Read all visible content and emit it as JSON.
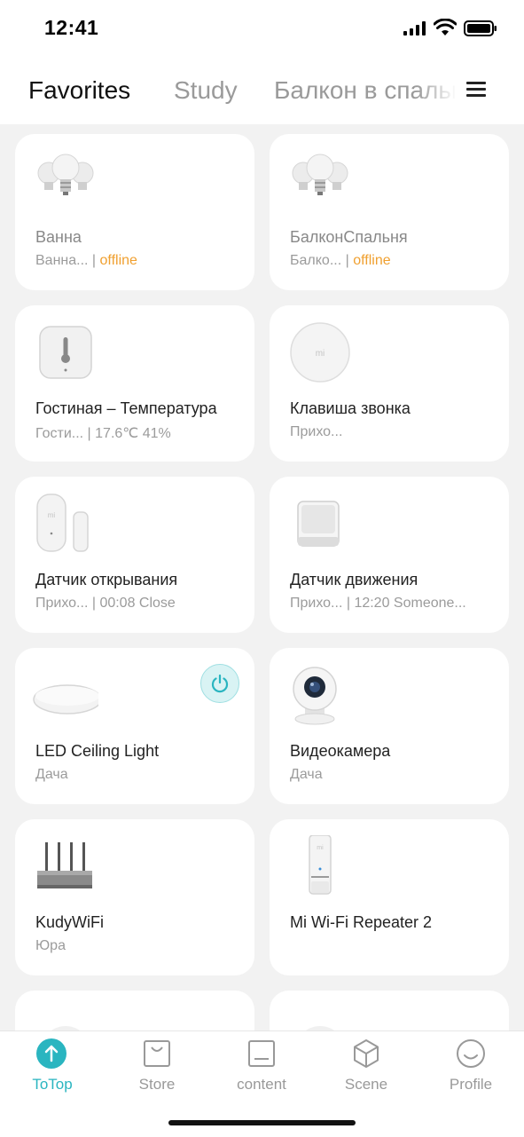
{
  "status": {
    "time": "12:41"
  },
  "tabs": [
    {
      "label": "Favorites"
    },
    {
      "label": "Study"
    },
    {
      "label": "Балкон в спальне"
    }
  ],
  "devices": [
    {
      "name": "Ванна",
      "room": "Ванна...",
      "status": "offline",
      "icon": "bulbs-icon"
    },
    {
      "name": "БалконСпальня",
      "room": "Балко...",
      "status": "offline",
      "icon": "bulbs-icon"
    },
    {
      "name": "Гостиная – Температура",
      "room": "Гости...",
      "status": "17.6℃ 41%",
      "icon": "thermometer-sensor-icon"
    },
    {
      "name": "Клавиша звонка",
      "room": "Прихо...",
      "status": "",
      "icon": "wireless-switch-icon"
    },
    {
      "name": "Датчик открывания",
      "room": "Прихо...",
      "status": "00:08 Close",
      "icon": "door-sensor-icon"
    },
    {
      "name": "Датчик движения",
      "room": "Прихо...",
      "status": "12:20 Someone...",
      "icon": "motion-sensor-icon"
    },
    {
      "name": " LED Ceiling Light",
      "room": "Дача",
      "status": "",
      "icon": "ceiling-light-icon"
    },
    {
      "name": "Видеокамера",
      "room": "Дача",
      "status": "",
      "icon": "camera-icon"
    },
    {
      "name": "KudyWiFi",
      "room": "Юра",
      "status": "",
      "icon": "router-icon"
    },
    {
      "name": "Mi Wi-Fi Repeater 2",
      "room": "",
      "status": "",
      "icon": "repeater-icon"
    }
  ],
  "separator": " | ",
  "nav": [
    {
      "label": "ToTop",
      "icon": "arrow-up-icon"
    },
    {
      "label": "Store",
      "icon": "bag-icon"
    },
    {
      "label": "content",
      "icon": "content-icon"
    },
    {
      "label": "Scene",
      "icon": "cube-icon"
    },
    {
      "label": "Profile",
      "icon": "smile-icon"
    }
  ],
  "colors": {
    "accent": "#2ab5c0",
    "offline": "#f0a030",
    "background": "#f2f2f2"
  }
}
